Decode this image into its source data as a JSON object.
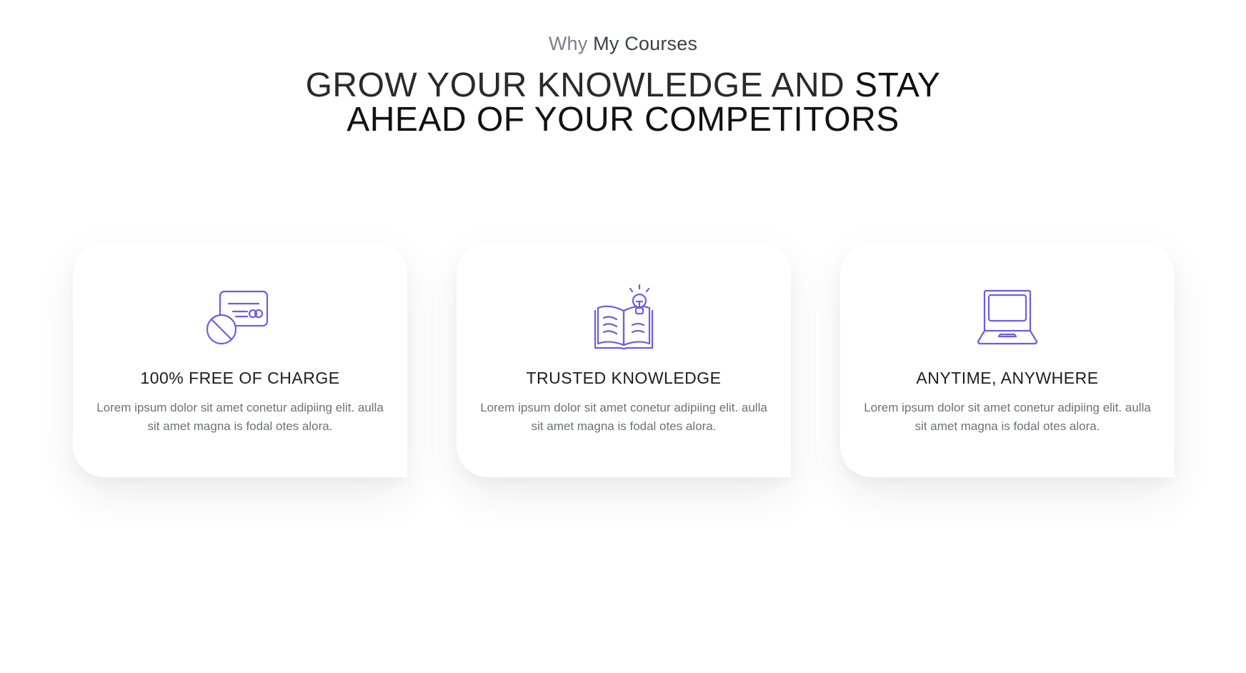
{
  "section": {
    "eyebrow_prefix": "Why",
    "eyebrow_highlight": "My Courses",
    "headline_light": "GROW YOUR KNOWLEDGE AND",
    "headline_bold_line1": "STAY",
    "headline_bold_line2": "AHEAD OF YOUR COMPETITORS"
  },
  "colors": {
    "accent": "#6c5ce7",
    "title_text": "#1d1d1f",
    "body_text": "#6e717a"
  },
  "cards": [
    {
      "icon": "credit-card-blocked-icon",
      "title": "100% FREE OF CHARGE",
      "description": "Lorem ipsum dolor sit amet conetur adipiing elit. aulla sit amet magna is fodal otes alora."
    },
    {
      "icon": "open-book-lightbulb-icon",
      "title": "TRUSTED KNOWLEDGE",
      "description": "Lorem ipsum dolor sit amet conetur adipiing elit. aulla sit amet magna is fodal otes alora."
    },
    {
      "icon": "laptop-icon",
      "title": "ANYTIME, ANYWHERE",
      "description": "Lorem ipsum dolor sit amet conetur adipiing elit. aulla sit amet magna is fodal otes alora."
    }
  ]
}
